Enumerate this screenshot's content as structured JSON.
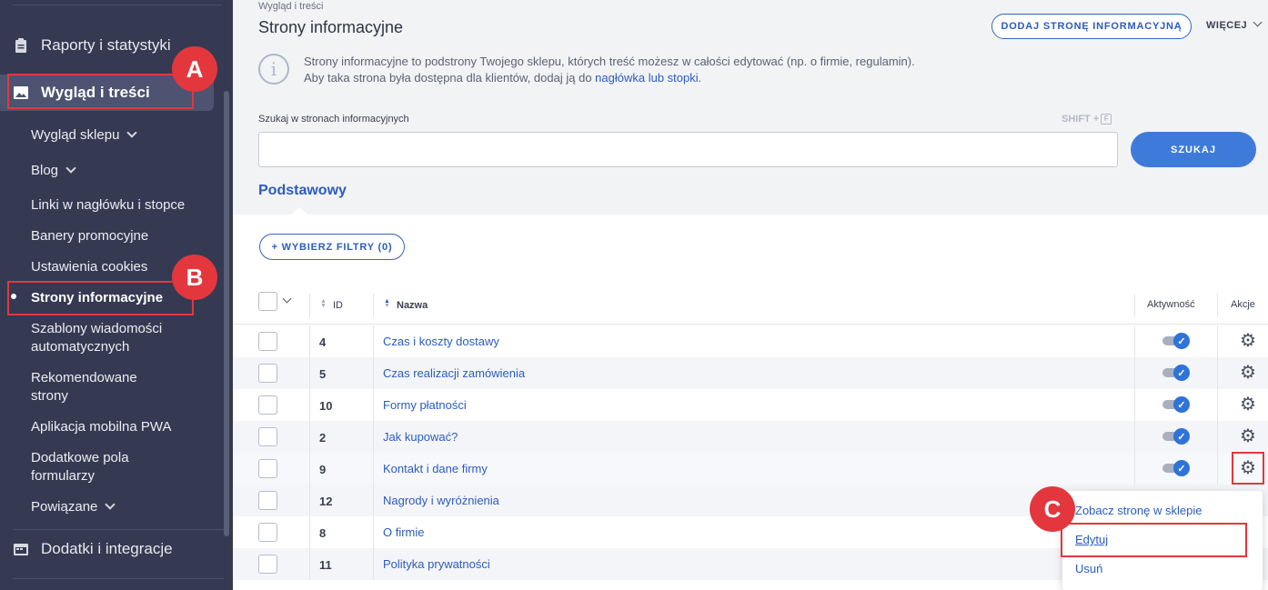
{
  "sidebar": {
    "reports": "Raporty i statystyki",
    "appearance": "Wygląd i treści",
    "items": [
      {
        "label": "Wygląd sklepu",
        "chevron": true
      },
      {
        "label": "Blog",
        "chevron": true
      },
      {
        "label": "Linki w nagłówku i stopce"
      },
      {
        "label": "Banery promocyjne"
      },
      {
        "label": "Ustawienia cookies"
      },
      {
        "label": "Strony informacyjne",
        "current": true
      },
      {
        "label": "Szablony wiadomości",
        "label2": "automatycznych"
      },
      {
        "label": "Rekomendowane",
        "label2": "strony"
      },
      {
        "label": "Aplikacja mobilna PWA"
      },
      {
        "label": "Dodatkowe pola",
        "label2": "formularzy"
      },
      {
        "label": "Powiązane",
        "chevron": true
      }
    ],
    "addons": "Dodatki i integracje"
  },
  "annotations": {
    "a": "A",
    "b": "B",
    "c": "C"
  },
  "header": {
    "breadcrumb": "Wygląd i treści",
    "title": "Strony informacyjne",
    "add_button": "DODAJ STRONĘ INFORMACYJNĄ",
    "more": "WIĘCEJ"
  },
  "info": {
    "line1": "Strony informacyjne to podstrony Twojego sklepu, których treść możesz w całości edytować (np. o firmie, regulamin).",
    "line2_prefix": "Aby taka strona była dostępna dla klientów, dodaj ją do ",
    "line2_link": "nagłówka lub stopki",
    "line2_suffix": "."
  },
  "search": {
    "label": "Szukaj w stronach informacyjnych",
    "shortcut": "SHIFT +",
    "shortcut_key": "F",
    "value": "",
    "button": "SZUKAJ"
  },
  "tab": "Podstawowy",
  "filter_button": "+ WYBIERZ FILTRY (0)",
  "table": {
    "headers": {
      "id": "ID",
      "name": "Nazwa",
      "active": "Aktywność",
      "actions": "Akcje"
    },
    "rows": [
      {
        "id": "4",
        "name": "Czas i koszty dostawy",
        "active": true
      },
      {
        "id": "5",
        "name": "Czas realizacji zamówienia",
        "active": true
      },
      {
        "id": "10",
        "name": "Formy płatności",
        "active": true
      },
      {
        "id": "2",
        "name": "Jak kupować?",
        "active": true
      },
      {
        "id": "9",
        "name": "Kontakt i dane firmy",
        "active": true
      },
      {
        "id": "12",
        "name": "Nagrody i wyróżnienia"
      },
      {
        "id": "8",
        "name": "O firmie"
      },
      {
        "id": "11",
        "name": "Polityka prywatności"
      }
    ]
  },
  "dropdown": {
    "view": "Zobacz stronę w sklepie",
    "edit": "Edytuj",
    "delete": "Usuń"
  }
}
